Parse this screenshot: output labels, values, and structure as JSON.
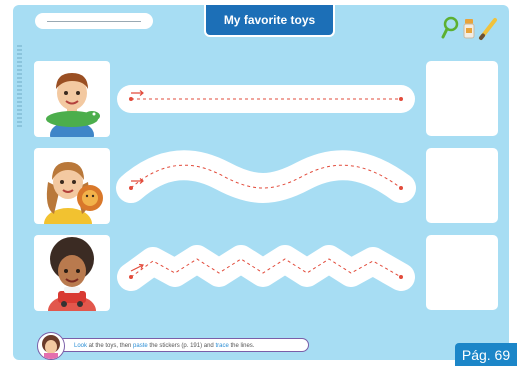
{
  "header": {
    "title": "My favorite toys",
    "name_line_label": ""
  },
  "tools": [
    {
      "name": "magnifier-icon",
      "color": "#5cb031"
    },
    {
      "name": "glue-stick-icon",
      "color": "#e8a33a"
    },
    {
      "name": "pencil-icon",
      "color": "#f0c23c"
    }
  ],
  "rows": [
    {
      "toy": "crocodile",
      "line_type": "straight",
      "character": "boy"
    },
    {
      "toy": "lion",
      "line_type": "wavy",
      "character": "girl"
    },
    {
      "toy": "car",
      "line_type": "zigzag",
      "character": "girl-curly-hair"
    }
  ],
  "instruction": {
    "word_look": "Look",
    "text_1": " at the toys, then ",
    "word_paste": "paste",
    "text_2": " the stickers (p. 191) and ",
    "word_trace": "trace",
    "text_3": " the lines."
  },
  "footer": {
    "page_label": "Pág. 69"
  },
  "colors": {
    "background": "#a7ddf3",
    "title_tab": "#1c6fb7",
    "page_badge": "#1c86c8",
    "trace_line": "#e24b3b"
  }
}
